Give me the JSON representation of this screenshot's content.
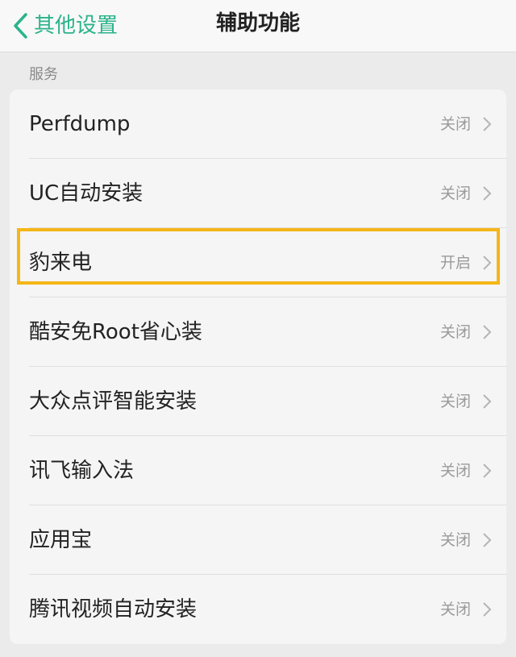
{
  "header": {
    "back_label": "其他设置",
    "title": "辅助功能"
  },
  "section": {
    "title": "服务"
  },
  "services": [
    {
      "label": "Perfdump",
      "status": "关闭"
    },
    {
      "label": "UC自动安装",
      "status": "关闭"
    },
    {
      "label": "豹来电",
      "status": "开启"
    },
    {
      "label": "酷安免Root省心装",
      "status": "关闭"
    },
    {
      "label": "大众点评智能安装",
      "status": "关闭"
    },
    {
      "label": "讯飞输入法",
      "status": "关闭"
    },
    {
      "label": "应用宝",
      "status": "关闭"
    },
    {
      "label": "腾讯视频自动安装",
      "status": "关闭"
    }
  ],
  "highlighted_service": "豹来电",
  "colors": {
    "accent": "#2bb38a",
    "highlight": "#f5b617"
  },
  "icons": {
    "back": "chevron-left-icon",
    "row": "chevron-right-icon"
  }
}
